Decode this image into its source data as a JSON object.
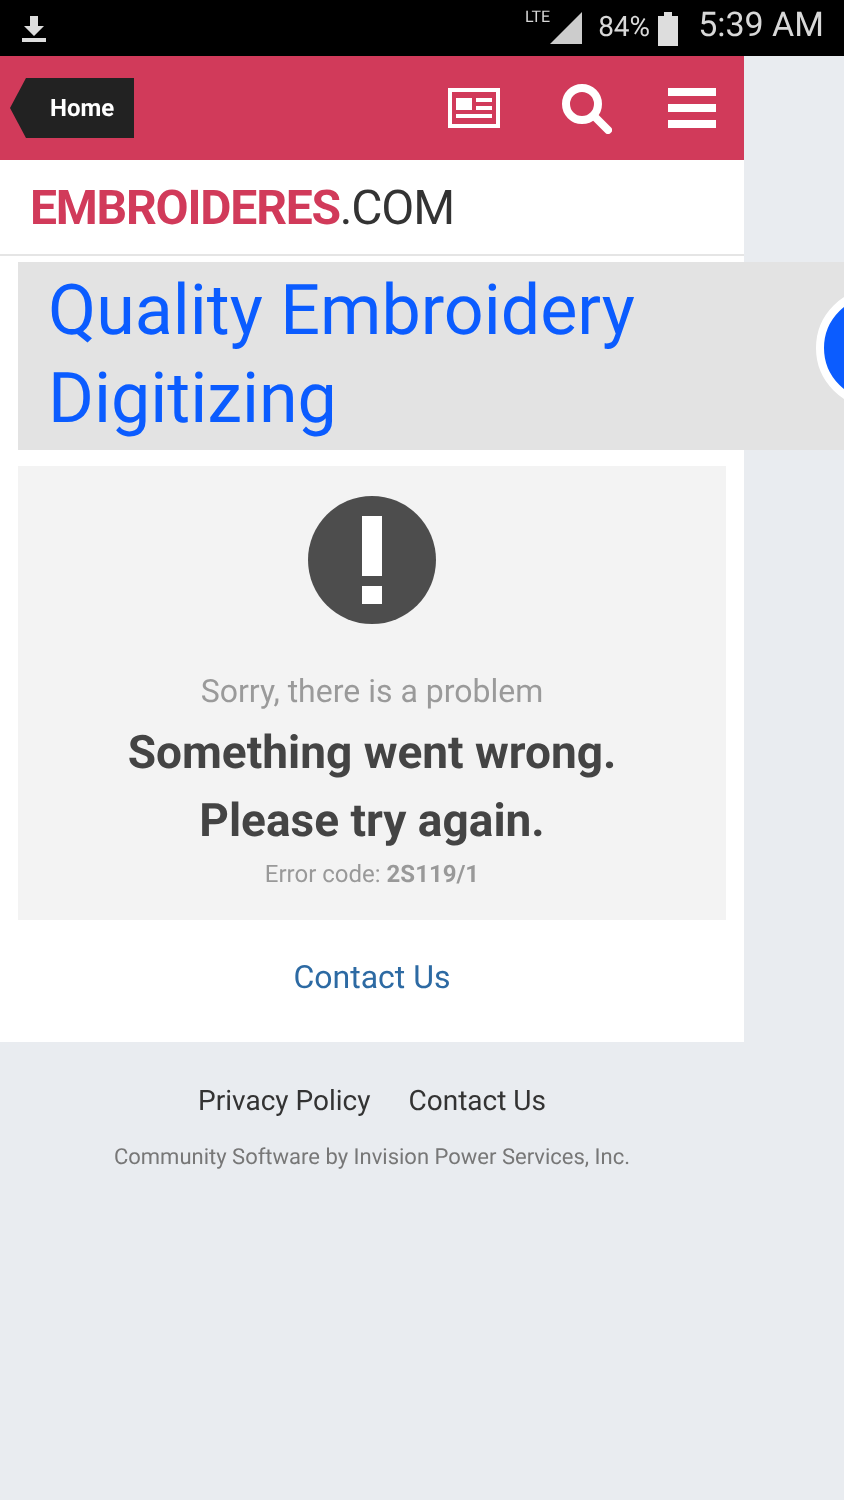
{
  "status_bar": {
    "network": "LTE",
    "battery": "84%",
    "time": "5:39 AM"
  },
  "header": {
    "home_button": "Home"
  },
  "logo": {
    "brand": "EMBROIDERES",
    "suffix": ".COM"
  },
  "banner": {
    "title": "Quality Embroidery Digitizing"
  },
  "error": {
    "subtitle": "Sorry, there is a problem",
    "message": "Something went wrong. Please try again.",
    "code": "Error code: **2S119/1**"
  },
  "contact_link": "Contact Us",
  "footer": {
    "links": [
      "Privacy Policy",
      "Contact Us"
    ],
    "credit": "Community Software by Invision Power Services, Inc."
  }
}
